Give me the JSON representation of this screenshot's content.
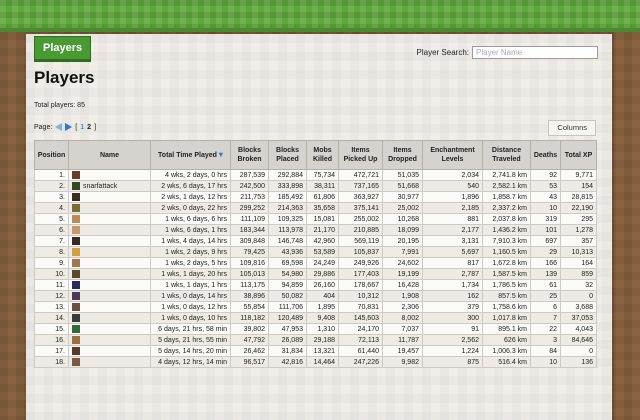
{
  "tab_label": "Players",
  "page_title": "Players",
  "search": {
    "label": "Player Search:",
    "placeholder": "Player Name",
    "value": ""
  },
  "total_players": "Total players: 85",
  "pager": {
    "label": "Page:",
    "prev": "",
    "next": "",
    "open": "[",
    "page1": "1",
    "page2": "2",
    "close": "]"
  },
  "columns_button": "Columns",
  "table": {
    "headers": [
      "Position",
      "Name",
      "Total Time Played",
      "Blocks Broken",
      "Blocks Placed",
      "Mobs Killed",
      "Items Picked Up",
      "Items Dropped",
      "Enchantment Levels",
      "Distance Traveled",
      "Deaths",
      "Total XP"
    ],
    "rows": [
      {
        "pos": "1.",
        "name": "",
        "time": "4 wks, 2 days, 0 hrs",
        "broken": "287,539",
        "placed": "292,884",
        "mobs": "75,734",
        "picked": "472,721",
        "dropped": "51,035",
        "ench": "2,034",
        "dist": "2,741.8 km",
        "deaths": "92",
        "xp": "9,771",
        "avatar": "#6a3b2a"
      },
      {
        "pos": "2.",
        "name": "snarfattack",
        "time": "2 wks, 6 days, 17 hrs",
        "broken": "242,500",
        "placed": "333,898",
        "mobs": "38,311",
        "picked": "737,165",
        "dropped": "51,668",
        "ench": "540",
        "dist": "2,582.1 km",
        "deaths": "53",
        "xp": "154",
        "avatar": "#2f4a22"
      },
      {
        "pos": "3.",
        "name": "",
        "time": "2 wks, 1 days, 12 hrs",
        "broken": "211,753",
        "placed": "185,492",
        "mobs": "61,806",
        "picked": "363,927",
        "dropped": "30,977",
        "ench": "1,896",
        "dist": "1,858.7 km",
        "deaths": "43",
        "xp": "28,815",
        "avatar": "#3b2c22"
      },
      {
        "pos": "4.",
        "name": "",
        "time": "2 wks, 0 days, 22 hrs",
        "broken": "299,252",
        "placed": "214,363",
        "mobs": "35,658",
        "picked": "375,141",
        "dropped": "25,002",
        "ench": "2,185",
        "dist": "2,337.2 km",
        "deaths": "10",
        "xp": "22,190",
        "avatar": "#7a6a3a"
      },
      {
        "pos": "5.",
        "name": "",
        "time": "1 wks, 6 days, 6 hrs",
        "broken": "111,109",
        "placed": "109,325",
        "mobs": "15,081",
        "picked": "255,002",
        "dropped": "10,268",
        "ench": "881",
        "dist": "2,037.8 km",
        "deaths": "319",
        "xp": "295",
        "avatar": "#b98a5a"
      },
      {
        "pos": "6.",
        "name": "",
        "time": "1 wks, 6 days, 1 hrs",
        "broken": "183,344",
        "placed": "113,978",
        "mobs": "21,170",
        "picked": "210,885",
        "dropped": "18,099",
        "ench": "2,177",
        "dist": "1,436.2 km",
        "deaths": "101",
        "xp": "1,278",
        "avatar": "#c49a6a"
      },
      {
        "pos": "7.",
        "name": "",
        "time": "1 wks, 4 days, 14 hrs",
        "broken": "309,848",
        "placed": "146,748",
        "mobs": "42,960",
        "picked": "569,119",
        "dropped": "20,195",
        "ench": "3,131",
        "dist": "7,910.3 km",
        "deaths": "697",
        "xp": "357",
        "avatar": "#3a2a22"
      },
      {
        "pos": "8.",
        "name": "",
        "time": "1 wks, 2 days, 9 hrs",
        "broken": "79,425",
        "placed": "43,936",
        "mobs": "53,589",
        "picked": "105,837",
        "dropped": "7,991",
        "ench": "5,697",
        "dist": "1,160.5 km",
        "deaths": "29",
        "xp": "10,313",
        "avatar": "#d1a040"
      },
      {
        "pos": "9.",
        "name": "",
        "time": "1 wks, 2 days, 5 hrs",
        "broken": "109,816",
        "placed": "69,598",
        "mobs": "24,249",
        "picked": "249,926",
        "dropped": "24,602",
        "ench": "817",
        "dist": "1,672.8 km",
        "deaths": "166",
        "xp": "164",
        "avatar": "#a07850"
      },
      {
        "pos": "10.",
        "name": "",
        "time": "1 wks, 1 days, 20 hrs",
        "broken": "105,013",
        "placed": "54,980",
        "mobs": "29,886",
        "picked": "177,403",
        "dropped": "19,199",
        "ench": "2,787",
        "dist": "1,587.5 km",
        "deaths": "139",
        "xp": "859",
        "avatar": "#5a4a2a"
      },
      {
        "pos": "11.",
        "name": "",
        "time": "1 wks, 1 days, 1 hrs",
        "broken": "113,175",
        "placed": "94,859",
        "mobs": "26,160",
        "picked": "178,667",
        "dropped": "16,428",
        "ench": "1,734",
        "dist": "1,786.5 km",
        "deaths": "61",
        "xp": "32",
        "avatar": "#2a2a5a"
      },
      {
        "pos": "12.",
        "name": "",
        "time": "1 wks, 0 days, 14 hrs",
        "broken": "38,896",
        "placed": "50,082",
        "mobs": "404",
        "picked": "10,312",
        "dropped": "1,908",
        "ench": "162",
        "dist": "857.5 km",
        "deaths": "25",
        "xp": "0",
        "avatar": "#4a3a5a"
      },
      {
        "pos": "13.",
        "name": "",
        "time": "1 wks, 0 days, 12 hrs",
        "broken": "55,854",
        "placed": "111,706",
        "mobs": "1,895",
        "picked": "70,831",
        "dropped": "2,306",
        "ench": "379",
        "dist": "1,758.6 km",
        "deaths": "6",
        "xp": "3,688",
        "avatar": "#6a5040"
      },
      {
        "pos": "14.",
        "name": "",
        "time": "1 wks, 0 days, 10 hrs",
        "broken": "118,182",
        "placed": "120,489",
        "mobs": "9,408",
        "picked": "145,603",
        "dropped": "8,002",
        "ench": "300",
        "dist": "1,017.8 km",
        "deaths": "7",
        "xp": "37,053",
        "avatar": "#3a3a3a"
      },
      {
        "pos": "15.",
        "name": "",
        "time": "6 days, 21 hrs, 58 min",
        "broken": "39,802",
        "placed": "47,953",
        "mobs": "1,310",
        "picked": "24,170",
        "dropped": "7,037",
        "ench": "91",
        "dist": "895.1 km",
        "deaths": "22",
        "xp": "4,043",
        "avatar": "#2f6a3a"
      },
      {
        "pos": "16.",
        "name": "",
        "time": "5 days, 21 hrs, 55 min",
        "broken": "47,792",
        "placed": "26,089",
        "mobs": "29,188",
        "picked": "72,113",
        "dropped": "11,787",
        "ench": "2,562",
        "dist": "626 km",
        "deaths": "3",
        "xp": "84,646",
        "avatar": "#9a7040"
      },
      {
        "pos": "17.",
        "name": "",
        "time": "5 days, 14 hrs, 20 min",
        "broken": "26,462",
        "placed": "31,834",
        "mobs": "13,321",
        "picked": "61,440",
        "dropped": "19,457",
        "ench": "1,224",
        "dist": "1,006.3 km",
        "deaths": "84",
        "xp": "0",
        "avatar": "#5a3a2a"
      },
      {
        "pos": "18.",
        "name": "",
        "time": "4 days, 12 hrs, 14 min",
        "broken": "96,517",
        "placed": "42,816",
        "mobs": "14,464",
        "picked": "247,226",
        "dropped": "9,982",
        "ench": "875",
        "dist": "516.4 km",
        "deaths": "10",
        "xp": "136",
        "avatar": "#7a5a40"
      }
    ]
  }
}
